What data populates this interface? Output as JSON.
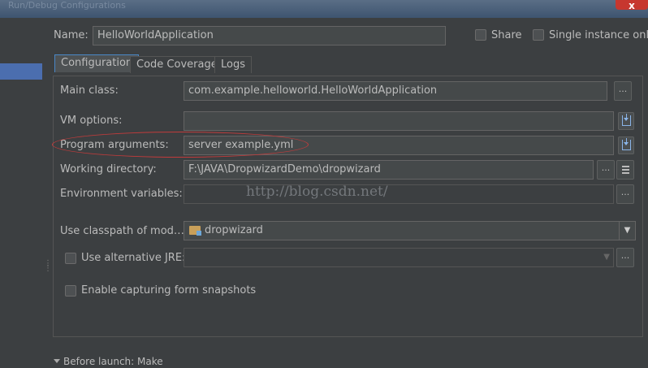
{
  "window": {
    "title": "Run/Debug Configurations",
    "close_label": "x"
  },
  "name_label": "Name:",
  "name_value": "HelloWorldApplication",
  "share_label": "Share",
  "single_instance_label": "Single instance only",
  "tabs": [
    {
      "label": "Configuration"
    },
    {
      "label": "Code Coverage"
    },
    {
      "label": "Logs"
    }
  ],
  "fields": {
    "main_class": {
      "label": "Main class:",
      "value": "com.example.helloworld.HelloWorldApplication"
    },
    "vm_options": {
      "label": "VM options:",
      "value": ""
    },
    "program_arguments": {
      "label": "Program arguments:",
      "value": "server example.yml"
    },
    "working_directory": {
      "label": "Working directory:",
      "value": "F:\\JAVA\\DropwizardDemo\\dropwizard"
    },
    "environment_variables": {
      "label": "Environment variables:",
      "value": ""
    },
    "use_classpath": {
      "label": "Use classpath of mod…",
      "value": "dropwizard"
    }
  },
  "alt_jre_label": "Use alternative JRE:",
  "capture_label": "Enable capturing form snapshots",
  "ellipsis": "...",
  "watermark": "http://blog.csdn.net/",
  "before_launch": "Before launch: Make",
  "colors": {
    "highlight": "#c23b3b",
    "selection": "#4b6eaf",
    "background": "#3c3f41"
  },
  "icons": [
    "close-icon",
    "import-icon",
    "folder-module-icon",
    "chevron-down-icon",
    "list-icon"
  ]
}
